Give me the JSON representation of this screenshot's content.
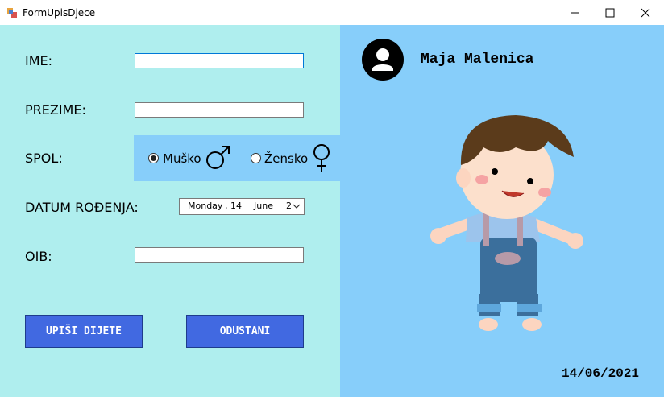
{
  "window": {
    "title": "FormUpisDjece"
  },
  "form": {
    "ime_label": "IME:",
    "ime_value": "",
    "prezime_label": "PREZIME:",
    "prezime_value": "",
    "spol_label": "SPOL:",
    "spol_options": [
      {
        "label": "Muško",
        "selected": true,
        "icon": "male-symbol-icon"
      },
      {
        "label": "Žensko",
        "selected": false,
        "icon": "female-symbol-icon"
      }
    ],
    "datum_label": "DATUM ROĐENJA:",
    "datum_value": {
      "day_name": "Monday",
      "day": ", 14",
      "month": "June",
      "year_partial": "2"
    },
    "oib_label": "OIB:",
    "oib_value": ""
  },
  "buttons": {
    "upisi": "UPIŠI DIJETE",
    "odustani": "ODUSTANI"
  },
  "user": {
    "name": "Maja Malenica",
    "avatar_icon": "user-avatar-icon"
  },
  "current_date": "14/06/2021",
  "colors": {
    "left_panel": "#afeeee",
    "right_panel": "#87cefa",
    "button": "#4169e1"
  }
}
